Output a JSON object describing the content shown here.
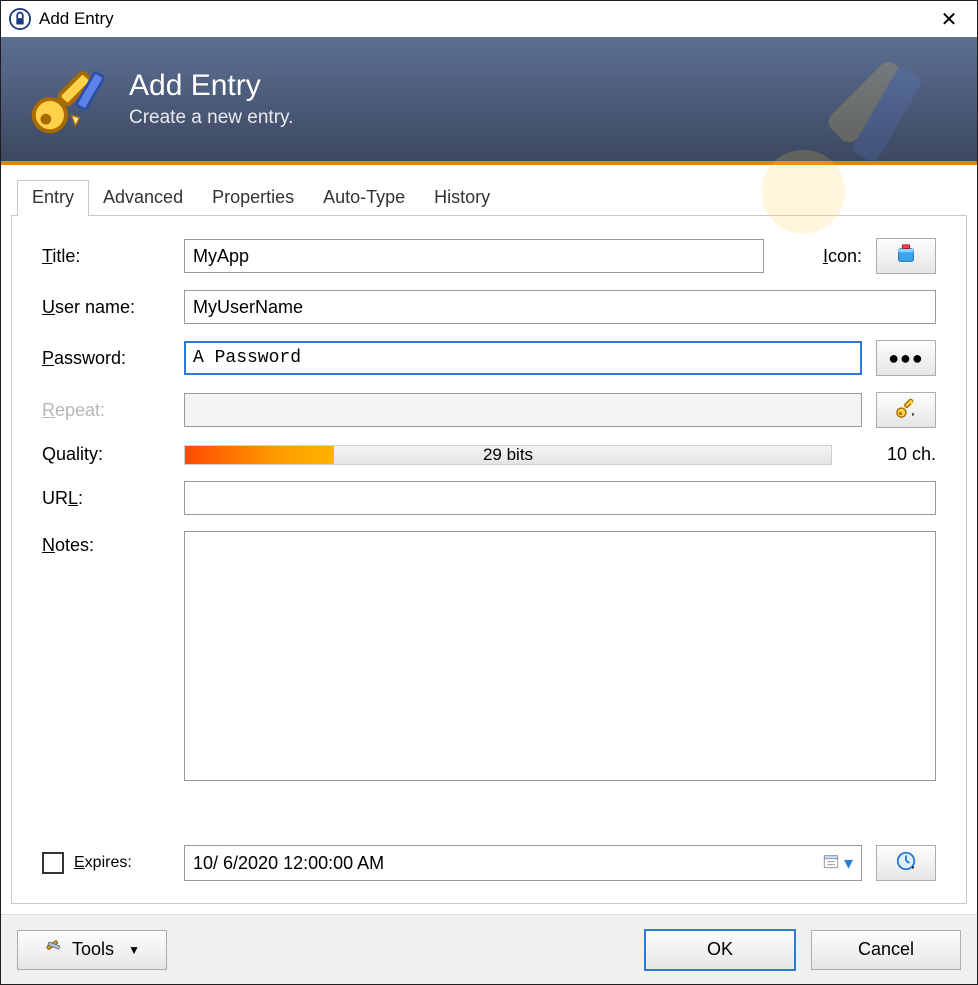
{
  "window": {
    "title": "Add Entry"
  },
  "banner": {
    "heading": "Add Entry",
    "subheading": "Create a new entry."
  },
  "tabs": {
    "entry": "Entry",
    "advanced": "Advanced",
    "properties": "Properties",
    "autotype": "Auto-Type",
    "history": "History"
  },
  "labels": {
    "title": "itle:",
    "icon": "con:",
    "username": "ser name:",
    "password": "assword:",
    "repeat": "epeat:",
    "quality": "Quality:",
    "url": "UR",
    "url_suffix": ":",
    "notes": "otes:",
    "expires": "xpires:"
  },
  "mnemonics": {
    "title": "T",
    "icon": "I",
    "username": "U",
    "password": "P",
    "repeat": "R",
    "url": "L",
    "notes": "N",
    "expires": "E"
  },
  "fields": {
    "title": "MyApp",
    "username": "MyUserName",
    "password": "A Password",
    "repeat": "",
    "url": "",
    "notes": "",
    "expires": "10/  6/2020 12:00:00 AM"
  },
  "quality": {
    "bits_label": "29 bits",
    "chars_label": "10 ch.",
    "fill_pct": 23
  },
  "footer": {
    "tools": "Tools",
    "ok": "OK",
    "cancel": "Cancel"
  }
}
